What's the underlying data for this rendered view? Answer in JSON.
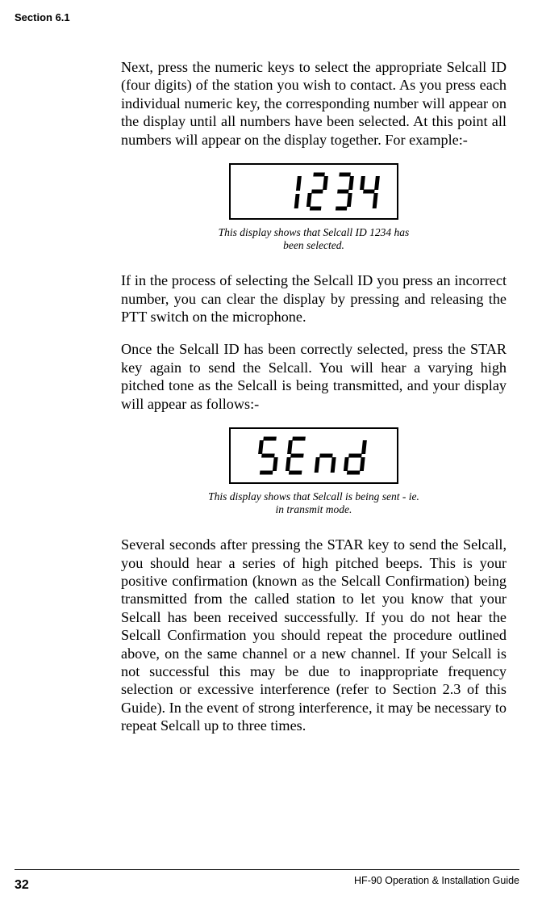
{
  "header": {
    "section": "Section 6.1"
  },
  "paragraphs": {
    "p1": "Next, press the numeric keys to select the appropriate Selcall ID (four digits) of the station you wish to contact.  As you press each individual numeric key, the corresponding number will appear on the display until all numbers have been selected.  At this point all numbers will appear on the display together.  For example:-",
    "caption1a": "This display shows that Selcall ID 1234 has",
    "caption1b": "been selected.",
    "p2": "If in the process of selecting the Selcall ID you press an incorrect number, you can clear the display by pressing and releasing the PTT switch on the microphone.",
    "p3": "Once the Selcall ID has been correctly selected, press the STAR key again to send the Selcall.  You will hear a varying high pitched tone as the Selcall is being transmitted, and your display will appear as follows:-",
    "caption2a": "This display shows that Selcall is being sent - ie.",
    "caption2b": "in transmit mode.",
    "p4": "Several seconds after pressing the STAR key to send the Selcall, you should hear a series of high pitched beeps.  This is your positive confirmation (known as the Selcall Confirmation) being transmitted from the called station to let you know that your Selcall has been received successfully.  If you do not hear the Selcall Confirmation you should repeat the procedure outlined above, on the same channel or a new channel.  If your Selcall is not successful this may be due to inappropriate frequency selection or excessive interference (refer to Section 2.3 of this Guide).  In the event of strong interference, it may be necessary to repeat Selcall up to three times."
  },
  "display": {
    "value1": "1234",
    "value2": "SEnd"
  },
  "footer": {
    "page": "32",
    "text": "HF-90 Operation & Installation Guide"
  }
}
